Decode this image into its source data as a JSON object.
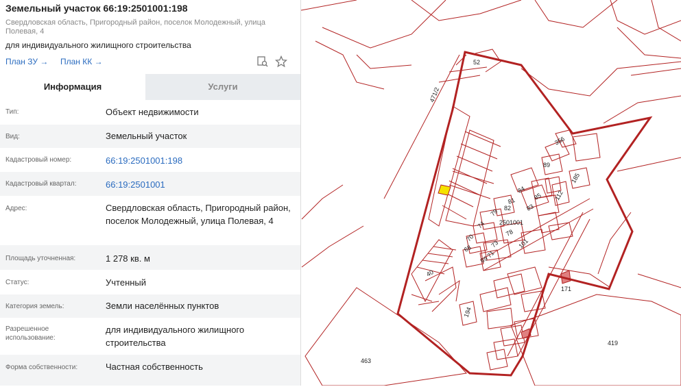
{
  "parcel": {
    "title": "Земельный участок 66:19:2501001:198",
    "address": "Свердловская область, Пригородный район, поселок Молодежный, улица Полевая, 4",
    "purpose": "для индивидуального жилищного строительства",
    "plan_zu_link": "План ЗУ →",
    "plan_kk_link": "План КК →"
  },
  "tabs": {
    "info": "Информация",
    "services": "Услуги"
  },
  "info_rows": [
    {
      "label": "Тип:",
      "value": "Объект недвижимости"
    },
    {
      "label": "Вид:",
      "value": "Земельный участок"
    },
    {
      "label": "Кадастровый номер:",
      "value": "66:19:2501001:198"
    },
    {
      "label": "Кадастровый квартал:",
      "value": "66:19:2501001"
    },
    {
      "label": "Адрес:",
      "value": "Свердловская область, Пригородный район, поселок Молодежный, улица Полевая, 4"
    },
    {
      "label": "Площадь уточненная:",
      "value": "1 278 кв. м"
    },
    {
      "label": "Статус:",
      "value": "Учтенный"
    },
    {
      "label": "Категория земель:",
      "value": "Земли населённых пунктов"
    },
    {
      "label": "Разрешенное использование:",
      "value": "для индивидуального жилищного строительства"
    },
    {
      "label": "Форма собственности:",
      "value": "Частная собственность"
    }
  ],
  "map": {
    "line_color": "#b22222",
    "highlight_color": "#f5e200",
    "labels": {
      "l52": "52",
      "l471": "471/2",
      "l356": "356",
      "l89": "89",
      "l185": "185",
      "l112": "112",
      "l84": "84",
      "l85": "85",
      "l81": "81",
      "l82": "82",
      "l83": "83",
      "l79": "79",
      "l2501001": "2501001",
      "l74": "74",
      "l78": "78",
      "l70": "70",
      "l73": "73",
      "l101": "101",
      "l68": "68",
      "l71": "71",
      "l69": "69",
      "l40": "40",
      "l171": "171",
      "l194": "194",
      "l463": "463",
      "l419": "419"
    }
  }
}
